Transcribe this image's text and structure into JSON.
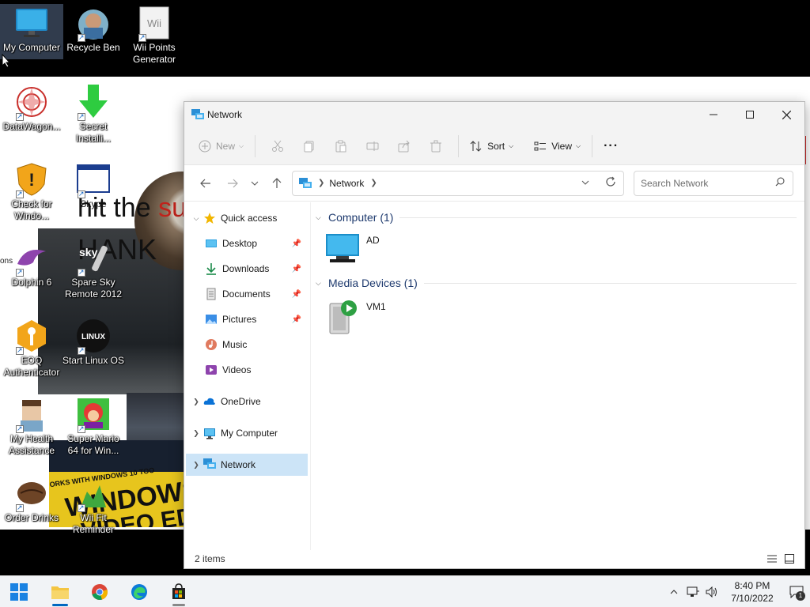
{
  "desktop": {
    "icons": [
      {
        "id": "my-computer",
        "label": "My Computer"
      },
      {
        "id": "recycle-bin",
        "label": "Recycle Ben"
      },
      {
        "id": "wii-points",
        "label": "Wii Points Generator",
        "icon_text": "Wii"
      },
      {
        "id": "datawagon",
        "label": "DataWagon..."
      },
      {
        "id": "secret-installing",
        "label": "Secret Installi..."
      },
      {
        "id": "check-windows",
        "label": "Check for Windo..."
      },
      {
        "id": "skype",
        "label": "Skype"
      },
      {
        "id": "dolphin",
        "label": "Dolphin 6"
      },
      {
        "id": "spare-sky",
        "label": "Spare Sky Remote 2012",
        "icon_text": "sky"
      },
      {
        "id": "eoq",
        "label": "EOQ Authenticator"
      },
      {
        "id": "start-linux",
        "label": "Start Linux OS",
        "icon_text": "LINUX"
      },
      {
        "id": "health",
        "label": "My Health Assistance"
      },
      {
        "id": "mario",
        "label": "Super Mario 64 for Win..."
      },
      {
        "id": "order-drinks",
        "label": "Order Drinks"
      },
      {
        "id": "wii-fit",
        "label": "Wii Fit Reminder"
      }
    ],
    "wallpaper": {
      "line1_plain": "hit the ",
      "line1_red": "su",
      "line2": "HANK",
      "banner_small": "ORKS WITH WINDOWS 10 TOO",
      "banner_big1": "WINDOWS",
      "banner_big2": "VIDEO EDIT",
      "side_text": "ons"
    }
  },
  "window": {
    "title": "Network",
    "toolbar": {
      "new": "New",
      "sort": "Sort",
      "view": "View",
      "more": "···"
    },
    "address": {
      "crumb": "Network"
    },
    "search": {
      "placeholder": "Search Network"
    },
    "nav": {
      "quick_access": "Quick access",
      "desktop": "Desktop",
      "downloads": "Downloads",
      "documents": "Documents",
      "pictures": "Pictures",
      "music": "Music",
      "videos": "Videos",
      "onedrive": "OneDrive",
      "my_computer": "My Computer",
      "network": "Network"
    },
    "groups": {
      "computer": {
        "title": "Computer (1)",
        "item": "AD"
      },
      "media": {
        "title": "Media Devices (1)",
        "item": "VM1"
      }
    },
    "status": {
      "count": "2 items"
    }
  },
  "taskbar": {
    "clock_time": "8:40 PM",
    "clock_date": "7/10/2022",
    "notifications": "1"
  },
  "colors": {
    "accent": "#0067c0",
    "selection": "#cce4f7",
    "group_header": "#1e3a6e",
    "folder_yellow": "#f4c542"
  }
}
